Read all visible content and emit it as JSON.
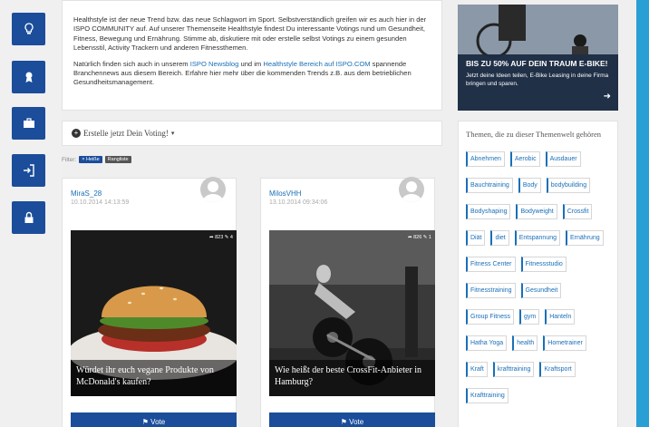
{
  "sidebar": {
    "icons": [
      "lightbulb-icon",
      "award-icon",
      "briefcase-icon",
      "login-icon",
      "lock-icon"
    ],
    "color": "#1b4d9b"
  },
  "intro": {
    "p1": "Healthstyle ist der neue Trend bzw. das neue Schlagwort im Sport. Selbstverständlich greifen wir es auch hier in der ISPO COMMUNITY auf. Auf unserer Themenseite Healthstyle findest Du interessante Votings rund um Gesundheit, Fitness, Bewegung und Ernährung. Stimme ab, diskutiere mit oder erstelle selbst Votings zu einem gesunden Lebensstil, Activity Trackern und anderen Fitnessthemen.",
    "p2_before": "Natürlich finden sich auch in unserem ",
    "p2_link1": "ISPO Newsblog",
    "p2_mid": " und im ",
    "p2_link2": "Healthstyle Bereich auf ISPO.COM",
    "p2_after": " spannende Branchennews aus diesem Bereich. Erfahre hier mehr über die kommenden Trends z.B. aus dem betrieblichen Gesundheitsmanagement."
  },
  "create_voting": {
    "plus": "+",
    "label": "Erstelle jetzt Dein Voting!",
    "caret": "▾"
  },
  "filter": {
    "label": "Filter:",
    "tags": [
      {
        "label": "× Heiße",
        "color": "#1b4d9b"
      },
      {
        "label": "Rangliste",
        "color": "#555555"
      }
    ]
  },
  "posts": [
    {
      "author": "MiraS_28",
      "date": "10.10.2014 14:13:59",
      "stats": "➦ 823  ✎ 4",
      "caption": "Würdet ihr euch vegane Produkte von McDonald's kaufen?",
      "vote_label": "⚑ Vote"
    },
    {
      "author": "MilosVHH",
      "date": "13.10.2014 09:34:06",
      "stats": "➦ 826  ✎ 1",
      "caption": "Wie heißt der beste CrossFit-Anbieter in Hamburg?",
      "vote_label": "⚑ Vote"
    }
  ],
  "ad": {
    "title": "BIS ZU 50% AUF DEIN TRAUM E-BIKE!",
    "subtitle": "Jetzt deine Ideen teilen, E-Bike Leasing in deine Firma bringen und sparen.",
    "arrow": "➜"
  },
  "themes": {
    "title": "Themen, die zu dieser Themenwelt gehören",
    "tags": [
      "Abnehmen",
      "Aerobic",
      "Ausdauer",
      "Bauchtraining",
      "Body",
      "bodybuilding",
      "Bodyshaping",
      "Bodyweight",
      "Crossfit",
      "Diät",
      "diet",
      "Entspannung",
      "Ernährung",
      "Fitness Center",
      "Fitnessstudio",
      "Fitnesstraining",
      "Gesundheit",
      "Group Fitness",
      "gym",
      "Hanteln",
      "Hatha Yoga",
      "health",
      "Hometrainer",
      "Kraft",
      "krafttraining",
      "Kraftsport",
      "Krafttraining"
    ]
  }
}
